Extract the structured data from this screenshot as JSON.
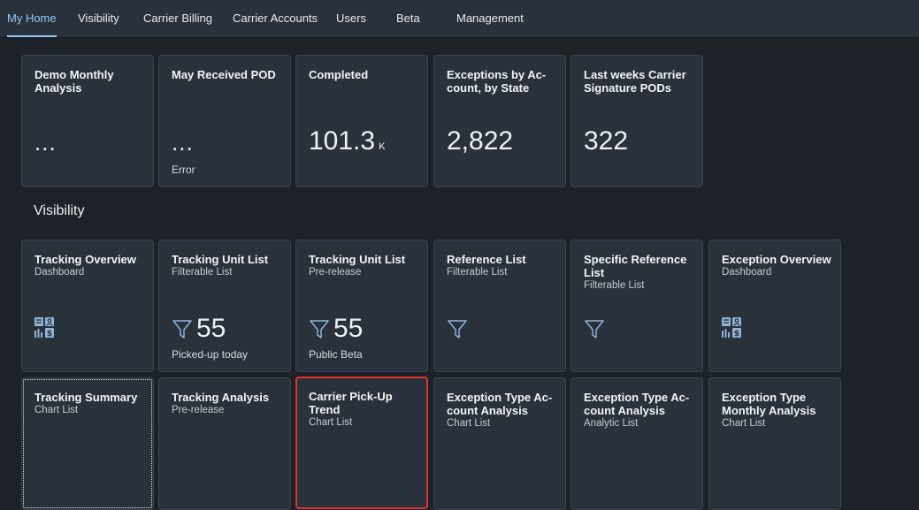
{
  "nav": {
    "tabs": [
      {
        "label": "My Home",
        "active": true
      },
      {
        "label": "Visibility"
      },
      {
        "label": "Carrier Billing"
      },
      {
        "label": "Carrier Accounts"
      },
      {
        "label": "Users"
      },
      {
        "label": "Beta"
      },
      {
        "label": "Management"
      }
    ]
  },
  "home_tiles": [
    {
      "title": "Demo Monthly Analysis",
      "value": "...",
      "footer": ""
    },
    {
      "title": "May Received POD",
      "value": "...",
      "footer": "Error"
    },
    {
      "title": "Completed",
      "value": "101.3",
      "unit": "K"
    },
    {
      "title": "Exceptions by Ac-count, by State",
      "value": "2,822"
    },
    {
      "title": "Last weeks Carrier Signature PODs",
      "value": "322"
    }
  ],
  "visibility": {
    "section_title": "Visibility",
    "row1": [
      {
        "title": "Tracking Overview",
        "subtitle": "Dashboard",
        "icon": "dashboard-icon"
      },
      {
        "title": "Tracking Unit List",
        "subtitle": "Filterable List",
        "icon": "filter-icon",
        "value": "55",
        "footer": "Picked-up today"
      },
      {
        "title": "Tracking Unit List",
        "subtitle": "Pre-release",
        "icon": "filter-icon",
        "value": "55",
        "footer": "Public Beta"
      },
      {
        "title": "Reference List",
        "subtitle": "Filterable List",
        "icon": "filter-icon"
      },
      {
        "title": "Specific Reference List",
        "subtitle": "Filterable List",
        "icon": "filter-icon"
      },
      {
        "title": "Exception Overview",
        "subtitle": "Dashboard",
        "icon": "dashboard-icon"
      }
    ],
    "row2": [
      {
        "title": "Tracking Summary",
        "subtitle": "Chart List"
      },
      {
        "title": "Tracking Analysis",
        "subtitle": "Pre-release"
      },
      {
        "title": "Carrier Pick-Up Trend",
        "subtitle": "Chart List"
      },
      {
        "title": "Exception Type Ac-count Analysis",
        "subtitle": "Chart List"
      },
      {
        "title": "Exception Type Ac-count Analysis",
        "subtitle": "Analytic List"
      },
      {
        "title": "Exception Type Monthly Analysis",
        "subtitle": "Chart List"
      }
    ]
  },
  "colors": {
    "background": "#1c2228",
    "tile": "#29313a",
    "accent": "#91c8f6",
    "icon": "#8fb3d6",
    "selected_border": "#e0352b"
  }
}
